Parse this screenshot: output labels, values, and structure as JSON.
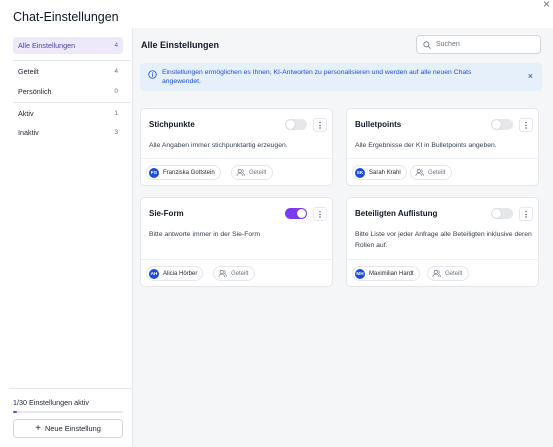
{
  "dialog": {
    "title": "Chat-Einstellungen",
    "close": "×"
  },
  "sidebar": {
    "items": [
      {
        "label": "Alle Einstellungen",
        "count": "4"
      },
      {
        "label": "Geteilt",
        "count": "4"
      },
      {
        "label": "Persönlich",
        "count": "0"
      },
      {
        "label": "Aktiv",
        "count": "1"
      },
      {
        "label": "Inaktiv",
        "count": "3"
      }
    ],
    "active_count_text": "1/30 Einstellungen aktiv",
    "active_progress": 0.033,
    "new_button_label": "Neue Einstellung",
    "new_button_icon": "+"
  },
  "main": {
    "title": "Alle Einstellungen",
    "search": {
      "placeholder": "Suchen",
      "value": ""
    },
    "info": {
      "text": "Einstellungen ermöglichen es Ihnen, KI-Antworten zu personalisieren und werden auf alle neuen Chats angewendet.",
      "close": "×"
    },
    "cards": [
      {
        "title": "Stichpunkte",
        "enabled": false,
        "description": "Alle Angaben immer stichpunktartig erzeugen.",
        "owner": "Franziska Gottstein",
        "initials": "FG",
        "shared_label": "Geteilt"
      },
      {
        "title": "Bulletpoints",
        "enabled": false,
        "description": "Alle Ergebnisse der KI in Bulletpoints angeben.",
        "owner": "Sarah Krahl",
        "initials": "SK",
        "shared_label": "Geteilt"
      },
      {
        "title": "Sie-Form",
        "enabled": true,
        "description": "Bitte antworte immer in der Sie-Form",
        "owner": "Alicia Hörber",
        "initials": "AH",
        "shared_label": "Geteilt"
      },
      {
        "title": "Beteiligten Auflistung",
        "enabled": false,
        "description": "Bitte Liste vor jeder Anfrage alle Beteiligten inklusive deren Rollen auf.",
        "owner": "Maximilian Hardt",
        "initials": "MH",
        "shared_label": "Geteilt"
      }
    ],
    "kebab_glyph": "⋮"
  },
  "colors": {
    "accent": "#7c3aed",
    "active_nav_bg": "#ede9fb",
    "info_bg": "#e6f0fb",
    "info_text": "#1d4ed8",
    "avatar": "#1d4ed8"
  }
}
